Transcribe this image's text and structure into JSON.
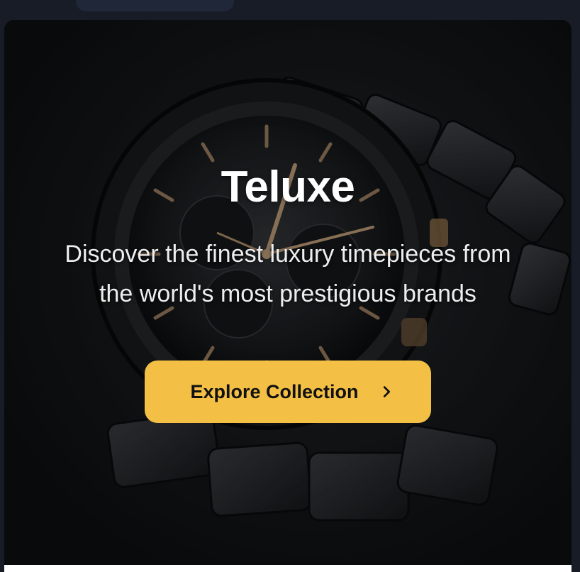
{
  "hero": {
    "title": "Teluxe",
    "tagline": "Discover the finest luxury timepieces from the world's most prestigious brands",
    "cta_label": "Explore Collection",
    "cta_icon": "chevron-right-icon",
    "image_subject": "luxury-watch",
    "accent_color": "#f3c045"
  }
}
